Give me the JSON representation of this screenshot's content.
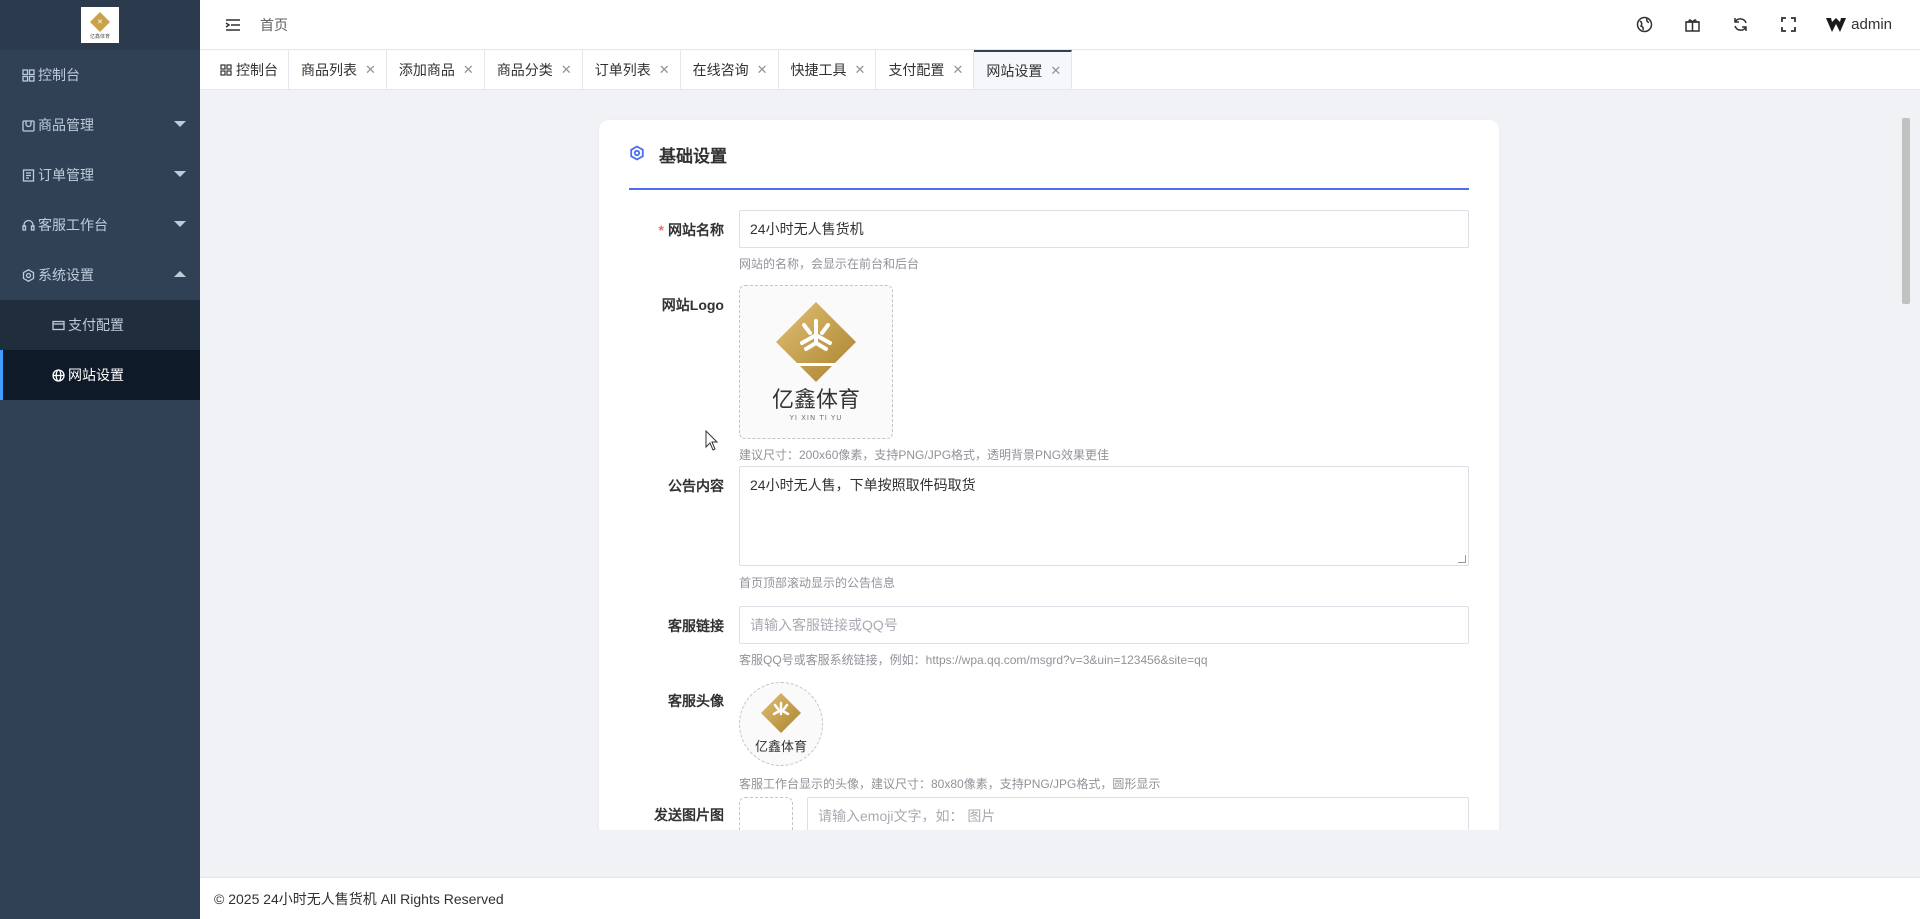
{
  "sidebar": {
    "logo_text": "亿鑫体育",
    "items": [
      {
        "label": "控制台",
        "icon": "dashboard-icon"
      },
      {
        "label": "商品管理",
        "icon": "goods-icon"
      },
      {
        "label": "订单管理",
        "icon": "order-icon"
      },
      {
        "label": "客服工作台",
        "icon": "headset-icon"
      },
      {
        "label": "系统设置",
        "icon": "gear-icon"
      }
    ],
    "sub_items": [
      {
        "label": "支付配置",
        "icon": "payment-icon"
      },
      {
        "label": "网站设置",
        "icon": "globe-icon"
      }
    ],
    "active_color": "#409eff"
  },
  "header": {
    "breadcrumb": "首页",
    "user": "admin",
    "icons": [
      "language-icon",
      "gift-icon",
      "refresh-icon",
      "fullscreen-icon"
    ]
  },
  "tabs": [
    {
      "label": "控制台",
      "closable": false
    },
    {
      "label": "商品列表",
      "closable": true
    },
    {
      "label": "添加商品",
      "closable": true
    },
    {
      "label": "商品分类",
      "closable": true
    },
    {
      "label": "订单列表",
      "closable": true
    },
    {
      "label": "在线咨询",
      "closable": true
    },
    {
      "label": "快捷工具",
      "closable": true
    },
    {
      "label": "支付配置",
      "closable": true
    },
    {
      "label": "网站设置",
      "closable": true,
      "active": true
    }
  ],
  "form": {
    "section_title": "基础设置",
    "site_name": {
      "label": "网站名称",
      "required": "*",
      "value": "24小时无人售货机",
      "hint": "网站的名称，会显示在前台和后台"
    },
    "site_logo": {
      "label": "网站Logo",
      "logo_cn": "亿鑫体育",
      "logo_en": "YI XIN TI YU",
      "hint": "建议尺寸：200x60像素，支持PNG/JPG格式，透明背景PNG效果更佳"
    },
    "notice": {
      "label": "公告内容",
      "value": "24小时无人售，下单按照取件码取货",
      "hint": "首页顶部滚动显示的公告信息"
    },
    "service_link": {
      "label": "客服链接",
      "placeholder": "请输入客服链接或QQ号",
      "hint": "客服QQ号或客服系统链接，例如：https://wpa.qq.com/msgrd?v=3&uin=123456&site=qq"
    },
    "service_avatar": {
      "label": "客服头像",
      "logo_cn": "亿鑫体育",
      "hint": "客服工作台显示的头像，建议尺寸：80x80像素，支持PNG/JPG格式，圆形显示"
    },
    "partial_row": {
      "label": "发送图片图",
      "placeholder": "请输入emoji文字，如：  图片"
    }
  },
  "footer": {
    "copyright": "© 2025 24小时无人售货机 All Rights Reserved"
  },
  "colors": {
    "sidebar_bg": "#304156",
    "accent": "#4e6ef2",
    "logo_gold": "#c9a24a"
  }
}
